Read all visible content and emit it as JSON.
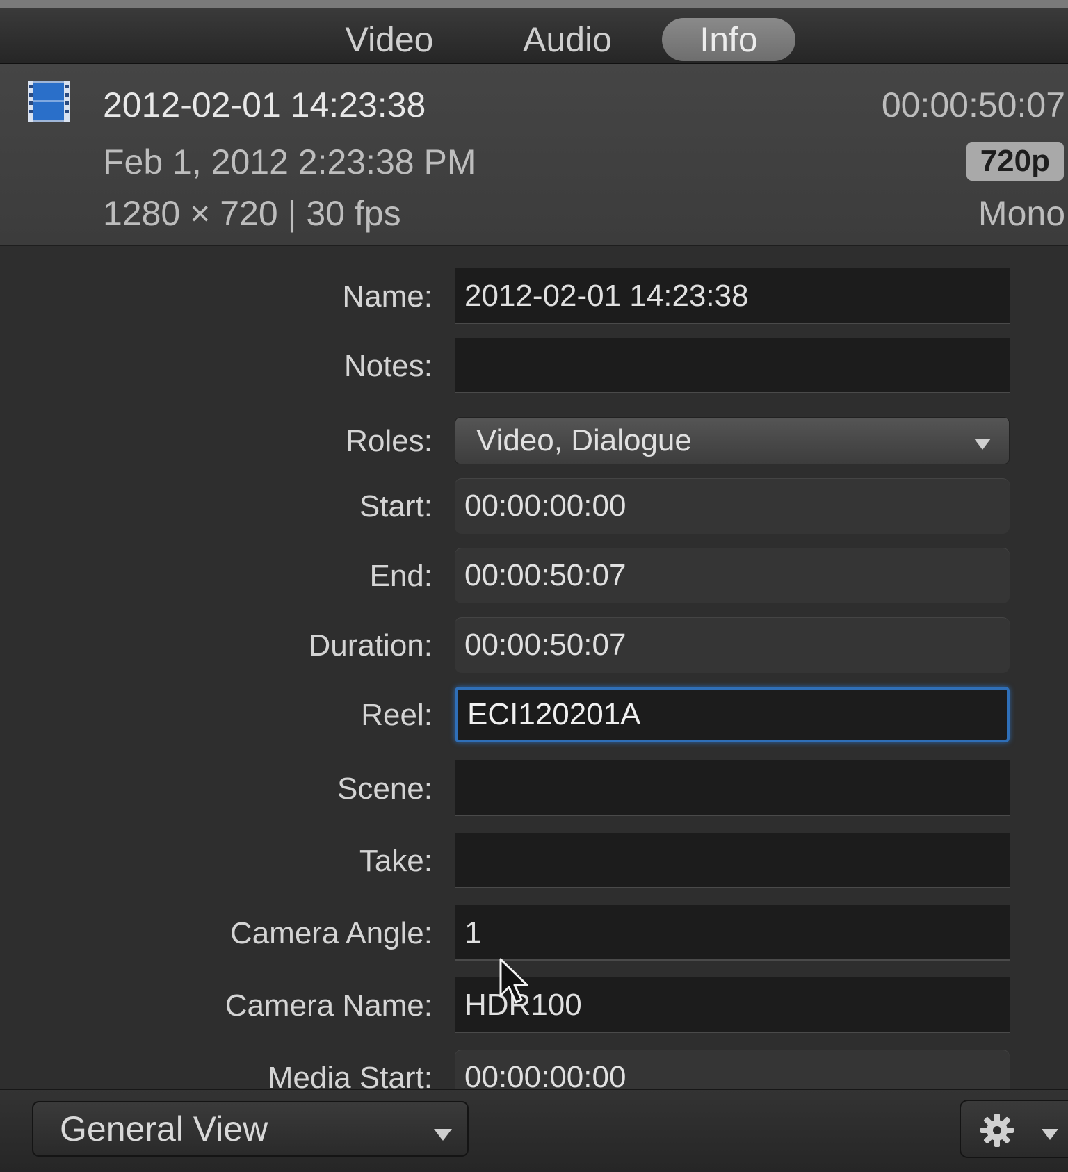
{
  "tabs": [
    {
      "label": "Video",
      "active": false
    },
    {
      "label": "Audio",
      "active": false
    },
    {
      "label": "Info",
      "active": true
    }
  ],
  "header": {
    "icon": "film-clip-icon",
    "title": "2012-02-01 14:23:38",
    "timecode": "00:00:50:07",
    "date": "Feb 1, 2012 2:23:38 PM",
    "format_badge": "720p",
    "spec": "1280 × 720 | 30 fps",
    "audio": "Mono"
  },
  "fields": {
    "name": {
      "label": "Name:",
      "value": "2012-02-01 14:23:38"
    },
    "notes": {
      "label": "Notes:",
      "value": ""
    },
    "roles": {
      "label": "Roles:",
      "value": "Video, Dialogue"
    },
    "start": {
      "label": "Start:",
      "value": "00:00:00:00"
    },
    "end": {
      "label": "End:",
      "value": "00:00:50:07"
    },
    "duration": {
      "label": "Duration:",
      "value": "00:00:50:07"
    },
    "reel": {
      "label": "Reel:",
      "value": "ECI120201A"
    },
    "scene": {
      "label": "Scene:",
      "value": ""
    },
    "take": {
      "label": "Take:",
      "value": ""
    },
    "camera_angle": {
      "label": "Camera Angle:",
      "value": "1"
    },
    "camera_name": {
      "label": "Camera Name:",
      "value": "HDR100"
    },
    "media_start": {
      "label": "Media Start:",
      "value": "00:00:00:00"
    }
  },
  "footer": {
    "view_label": "General View",
    "action_icon": "gear-icon"
  },
  "colors": {
    "focus_ring": "#2f6fb8",
    "clip_icon": "#2a6fc9"
  }
}
